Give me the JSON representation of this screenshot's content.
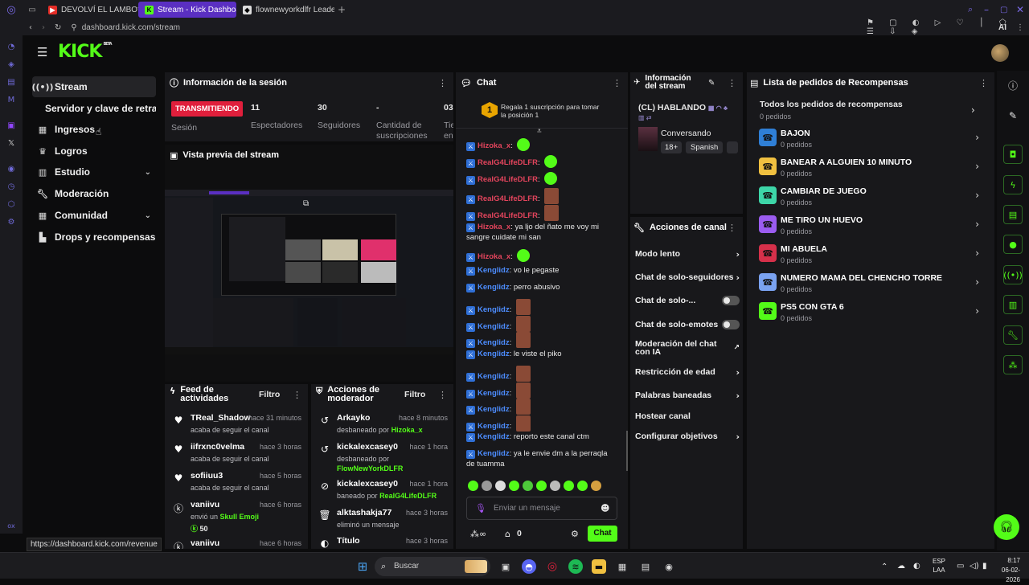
{
  "browser": {
    "tabs": [
      {
        "label": "DEVOLVÍ EL LAMBO? | WE"
      },
      {
        "label": "Stream - Kick Dashboard"
      },
      {
        "label": "flownewyorkdlfr LeaderBo"
      }
    ],
    "url": "dashboard.kick.com/stream",
    "status_url": "https://dashboard.kick.com/revenue"
  },
  "header": {
    "logo": "KICK",
    "logo_sup": "BETA"
  },
  "nav": {
    "items": [
      {
        "label": "Stream"
      },
      {
        "label": "Servidor y clave de retransmisión"
      },
      {
        "label": "Ingresos"
      },
      {
        "label": "Logros"
      },
      {
        "label": "Estudio"
      },
      {
        "label": "Moderación"
      },
      {
        "label": "Comunidad"
      },
      {
        "label": "Drops y recompensas"
      }
    ]
  },
  "session": {
    "title": "Información de la sesión",
    "status_badge": "TRANSMITIENDO",
    "status_label": "Sesión",
    "stats": [
      {
        "value": "11",
        "label": "Espectadores"
      },
      {
        "value": "30",
        "label": "Seguidores"
      },
      {
        "value": "-",
        "label": "Cantidad de suscripciones"
      },
      {
        "value": "03",
        "label": "Tie en"
      }
    ]
  },
  "preview": {
    "title": "Vista previa del stream"
  },
  "feed": {
    "title": "Feed de actividades",
    "filter": "Filtro",
    "items": [
      {
        "name": "TReal_Shadow",
        "time": "hace 31 minutos",
        "desc": "acaba de seguir el canal"
      },
      {
        "name": "iifrxnc0velma",
        "time": "hace 3 horas",
        "desc": "acaba de seguir el canal"
      },
      {
        "name": "sofiiuu3",
        "time": "hace 5 horas",
        "desc": "acaba de seguir el canal"
      },
      {
        "name": "vaniivu",
        "time": "hace 6 horas",
        "desc": "envió un",
        "extra": "Skull Emoji",
        "amount": "50"
      },
      {
        "name": "vaniivu",
        "time": "hace 6 horas",
        "desc": ""
      }
    ]
  },
  "modactions": {
    "title": "Acciones de moderador",
    "filter": "Filtro",
    "items": [
      {
        "name": "Arkayko",
        "time": "hace 8 minutos",
        "desc": "desbaneado por",
        "by": "Hizoka_x"
      },
      {
        "name": "kickalexcasey0",
        "time": "hace 1 hora",
        "desc": "desbaneado por",
        "by": "FlowNewYorkDLFR"
      },
      {
        "name": "kickalexcasey0",
        "time": "hace 1 hora",
        "desc": "baneado por",
        "by": "RealG4LifeDLFR"
      },
      {
        "name": "alktashakja77",
        "time": "hace 3 horas",
        "desc": "eliminó un mensaje",
        "by": ""
      },
      {
        "name": "Título",
        "time": "hace 3 horas",
        "desc": "",
        "by": ""
      }
    ]
  },
  "chat": {
    "title": "Chat",
    "sub_goal": "Regala 1 suscripción para tomar la posición 1",
    "sub_goal_rank": "1",
    "messages": [
      {
        "user": "Hizoka_x",
        "color": "red",
        "text": "",
        "emote": "green"
      },
      {
        "user": "RealG4LifeDLFR",
        "color": "red",
        "text": "",
        "emote": "green"
      },
      {
        "user": "RealG4LifeDLFR",
        "color": "red",
        "text": "",
        "emote": "green"
      },
      {
        "user": "RealG4LifeDLFR",
        "color": "red",
        "text": "",
        "emote": "img"
      },
      {
        "user": "RealG4LifeDLFR",
        "color": "red",
        "text": "",
        "emote": "img"
      },
      {
        "user": "Hizoka_x",
        "color": "red",
        "text": "ya ljo del ñato me voy mi sangre cuidate mi san",
        "emote": ""
      },
      {
        "user": "Hizoka_x",
        "color": "red",
        "text": "",
        "emote": "green"
      },
      {
        "user": "Kenglidz",
        "color": "blue",
        "text": "vo le pegaste",
        "emote": ""
      },
      {
        "user": "Kenglidz",
        "color": "blue",
        "text": "perro abusivo",
        "emote": ""
      },
      {
        "user": "Kenglidz",
        "color": "blue",
        "text": "",
        "emote": "img"
      },
      {
        "user": "Kenglidz",
        "color": "blue",
        "text": "",
        "emote": "img"
      },
      {
        "user": "Kenglidz",
        "color": "blue",
        "text": "",
        "emote": "img"
      },
      {
        "user": "Kenglidz",
        "color": "blue",
        "text": "le viste el piko",
        "emote": ""
      },
      {
        "user": "Kenglidz",
        "color": "blue",
        "text": "",
        "emote": "img"
      },
      {
        "user": "Kenglidz",
        "color": "blue",
        "text": "",
        "emote": "img"
      },
      {
        "user": "Kenglidz",
        "color": "blue",
        "text": "",
        "emote": "img"
      },
      {
        "user": "Kenglidz",
        "color": "blue",
        "text": "",
        "emote": "img"
      },
      {
        "user": "Kenglidz",
        "color": "blue",
        "text": "reporto este canal ctm",
        "emote": ""
      },
      {
        "user": "Kenglidz",
        "color": "blue",
        "text": "ya le envie dm a la perraqla de tuamma",
        "emote": ""
      }
    ],
    "placeholder": "Enviar un mensaje",
    "points": "0",
    "send": "Chat"
  },
  "stream_info": {
    "title": "Información del stream",
    "stream_title": "(CL) HABLANDO",
    "category": "Conversando",
    "tags": [
      "18+",
      "Spanish"
    ]
  },
  "channel_actions": {
    "title": "Acciones de canal",
    "items": [
      {
        "label": "Modo lento",
        "kind": "arrow"
      },
      {
        "label": "Chat de solo-seguidores",
        "kind": "arrow"
      },
      {
        "label": "Chat de solo-...",
        "kind": "toggle"
      },
      {
        "label": "Chat de solo-emotes",
        "kind": "toggle"
      },
      {
        "label": "Moderación del chat con IA",
        "kind": "ext"
      },
      {
        "label": "Restricción de edad",
        "kind": "arrow"
      },
      {
        "label": "Palabras baneadas",
        "kind": "arrow"
      },
      {
        "label": "Hostear canal",
        "kind": "none"
      },
      {
        "label": "Configurar objetivos",
        "kind": "arrow"
      }
    ]
  },
  "rewards": {
    "title": "Lista de pedidos de Recompensas",
    "all_label": "Todos los pedidos de recompensas",
    "all_count": "0 pedidos",
    "items": [
      {
        "label": "BAJON",
        "count": "0 pedidos",
        "color": "#2f7fd6"
      },
      {
        "label": "BANEAR A ALGUIEN 10 MINUTO",
        "count": "0 pedidos",
        "color": "#f0c040"
      },
      {
        "label": "CAMBIAR DE JUEGO",
        "count": "0 pedidos",
        "color": "#3dd6a8"
      },
      {
        "label": "ME TIRO UN HUEVO",
        "count": "0 pedidos",
        "color": "#9b5cf0"
      },
      {
        "label": "MI ABUELA",
        "count": "0 pedidos",
        "color": "#d6304a"
      },
      {
        "label": "NUMERO MAMA DEL CHENCHO TORRE",
        "count": "0 pedidos",
        "color": "#7aa2f0"
      },
      {
        "label": "PS5 CON GTA 6",
        "count": "0 pedidos",
        "color": "#53fc18"
      }
    ]
  },
  "taskbar": {
    "search": "Buscar",
    "lang": "ESP",
    "lang2": "LAA",
    "time": "8:17",
    "date": "06-02-2026"
  }
}
